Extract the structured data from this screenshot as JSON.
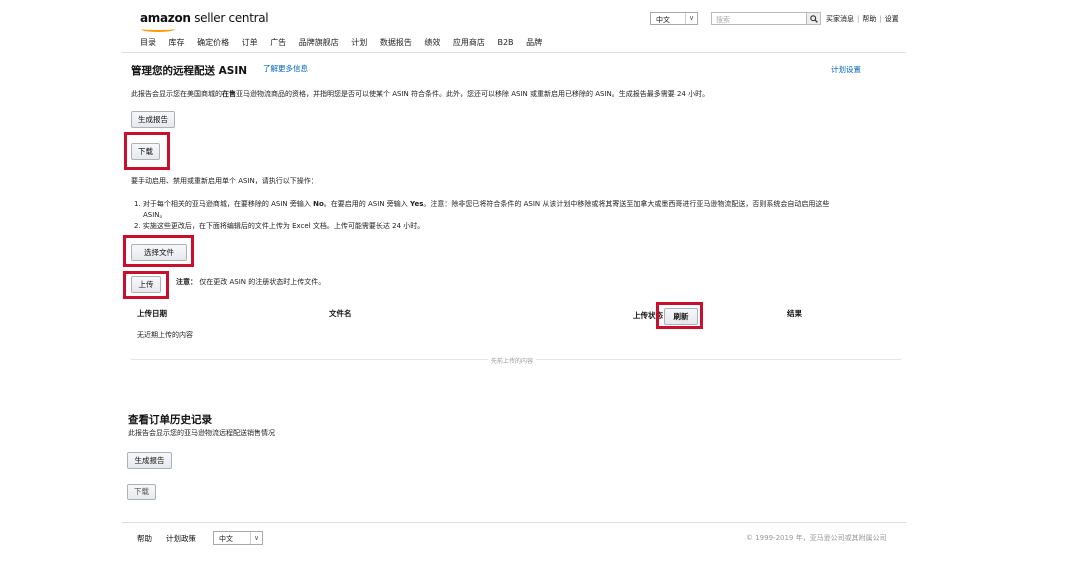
{
  "header": {
    "logo_brand": "amazon",
    "logo_product": "seller central",
    "language_value": "中文",
    "search_placeholder": "搜索",
    "top_links": [
      "买家消息",
      "帮助",
      "设置"
    ]
  },
  "nav": {
    "items": [
      "目录",
      "库存",
      "确定价格",
      "订单",
      "广告",
      "品牌旗舰店",
      "计划",
      "数据报告",
      "绩效",
      "应用商店",
      "B2B",
      "品牌"
    ]
  },
  "main": {
    "title": "管理您的远程配送 ASIN",
    "learn_more": "了解更多信息",
    "plan_settings": "计划设置",
    "desc_a": "此报告会显示您在美国商城的",
    "desc_b": "在售",
    "desc_c": "亚马逊物流商品的资格，并指明您是否可以使某个 ASIN 符合条件。此外，您还可以移除 ASIN 或重新启用已移除的 ASIN。生成报告最多需要 24 小时。",
    "generate_report": "生成报告",
    "download": "下载",
    "manual_intro": "要手动启用、禁用或重新启用单个 ASIN，请执行以下操作：",
    "step1_a": "1. 对于每个相关的亚马逊商城，在要移除的 ASIN 旁输入 ",
    "step1_no": "No",
    "step1_b": "。在要启用的 ASIN 旁输入 ",
    "step1_yes": "Yes",
    "step1_c": "。注意：除非您已将符合条件的 ASIN 从该计划中移除或将其寄送至加拿大或墨西哥进行亚马逊物流配送，否则系统会自动启用这些",
    "step1_d": "ASIN。",
    "step2": "2. 实施这些更改后，在下面将编辑后的文件上传为 Excel 文档。上传可能需要长达 24 小时。",
    "choose_file": "选择文件",
    "upload": "上传",
    "note_label": "注意：",
    "note_text": "仅在更改 ASIN 的注册状态时上传文件。",
    "table": {
      "col_date": "上传日期",
      "col_file": "文件名",
      "col_status": "上传状态",
      "refresh": "刷新",
      "col_result": "结果",
      "empty": "无近期上传的内容",
      "previous_uploads": "先前上传的内容"
    }
  },
  "order_history": {
    "title": "查看订单历史记录",
    "desc": "此报告会显示您的亚马逊物流远程配送销售情况",
    "generate_report": "生成报告",
    "download": "下载"
  },
  "footer": {
    "help": "帮助",
    "policy": "计划政策",
    "language_value": "中文",
    "copyright": "© 1999-2019 年，亚马逊公司或其附属公司"
  },
  "colors": {
    "link": "#0066c0",
    "highlight_box": "#c8102e",
    "logo_smile": "#ff9900"
  }
}
